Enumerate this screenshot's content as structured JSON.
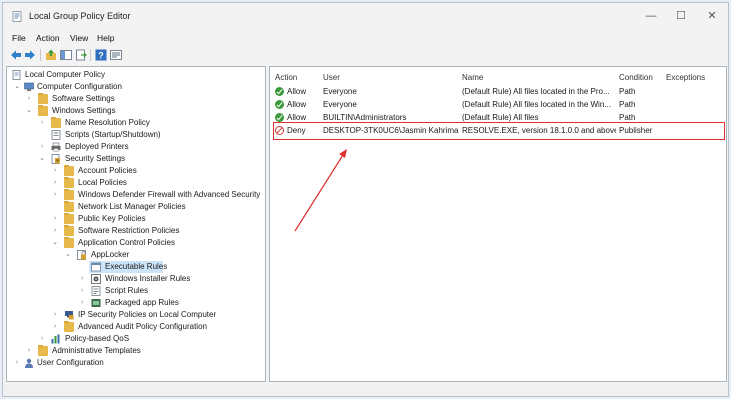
{
  "window": {
    "title": "Local Group Policy Editor",
    "minimize": "—",
    "maximize": "☐",
    "close": "✕"
  },
  "menu": [
    "File",
    "Action",
    "View",
    "Help"
  ],
  "toolbar": [
    "back-icon",
    "forward-icon",
    "up-icon",
    "show-hide-tree-icon",
    "export-list-icon",
    "help-icon",
    "properties-icon"
  ],
  "tree": [
    {
      "label": "Local Computer Policy"
    },
    {
      "label": "Computer Configuration"
    },
    {
      "label": "Software Settings"
    },
    {
      "label": "Windows Settings"
    },
    {
      "label": "Name Resolution Policy"
    },
    {
      "label": "Scripts (Startup/Shutdown)"
    },
    {
      "label": "Deployed Printers"
    },
    {
      "label": "Security Settings"
    },
    {
      "label": "Account Policies"
    },
    {
      "label": "Local Policies"
    },
    {
      "label": "Windows Defender Firewall with Advanced Security"
    },
    {
      "label": "Network List Manager Policies"
    },
    {
      "label": "Public Key Policies"
    },
    {
      "label": "Software Restriction Policies"
    },
    {
      "label": "Application Control Policies"
    },
    {
      "label": "AppLocker"
    },
    {
      "label": "Executable Rules"
    },
    {
      "label": "Windows Installer Rules"
    },
    {
      "label": "Script Rules"
    },
    {
      "label": "Packaged app Rules"
    },
    {
      "label": "IP Security Policies on Local Computer"
    },
    {
      "label": "Advanced Audit Policy Configuration"
    },
    {
      "label": "Policy-based QoS"
    },
    {
      "label": "Administrative Templates"
    },
    {
      "label": "User Configuration"
    }
  ],
  "list": {
    "columns": [
      "Action",
      "User",
      "Name",
      "Condition",
      "Exceptions"
    ],
    "rows": [
      {
        "action": "Allow",
        "user": "Everyone",
        "name": "(Default Rule) All files located in the Pro...",
        "condition": "Path",
        "exceptions": ""
      },
      {
        "action": "Allow",
        "user": "Everyone",
        "name": "(Default Rule) All files located in the Win...",
        "condition": "Path",
        "exceptions": ""
      },
      {
        "action": "Allow",
        "user": "BUILTIN\\Administrators",
        "name": "(Default Rule) All files",
        "condition": "Path",
        "exceptions": ""
      },
      {
        "action": "Deny",
        "user": "DESKTOP-3TK0UC6\\Jasmin Kahriman",
        "name": "RESOLVE.EXE, version 18.1.0.0 and above,...",
        "condition": "Publisher",
        "exceptions": ""
      }
    ]
  },
  "colors": {
    "highlight": "#e03030",
    "selection": "#cce4f7",
    "allow": "#3a9a3a",
    "deny": "#d23a3a"
  }
}
